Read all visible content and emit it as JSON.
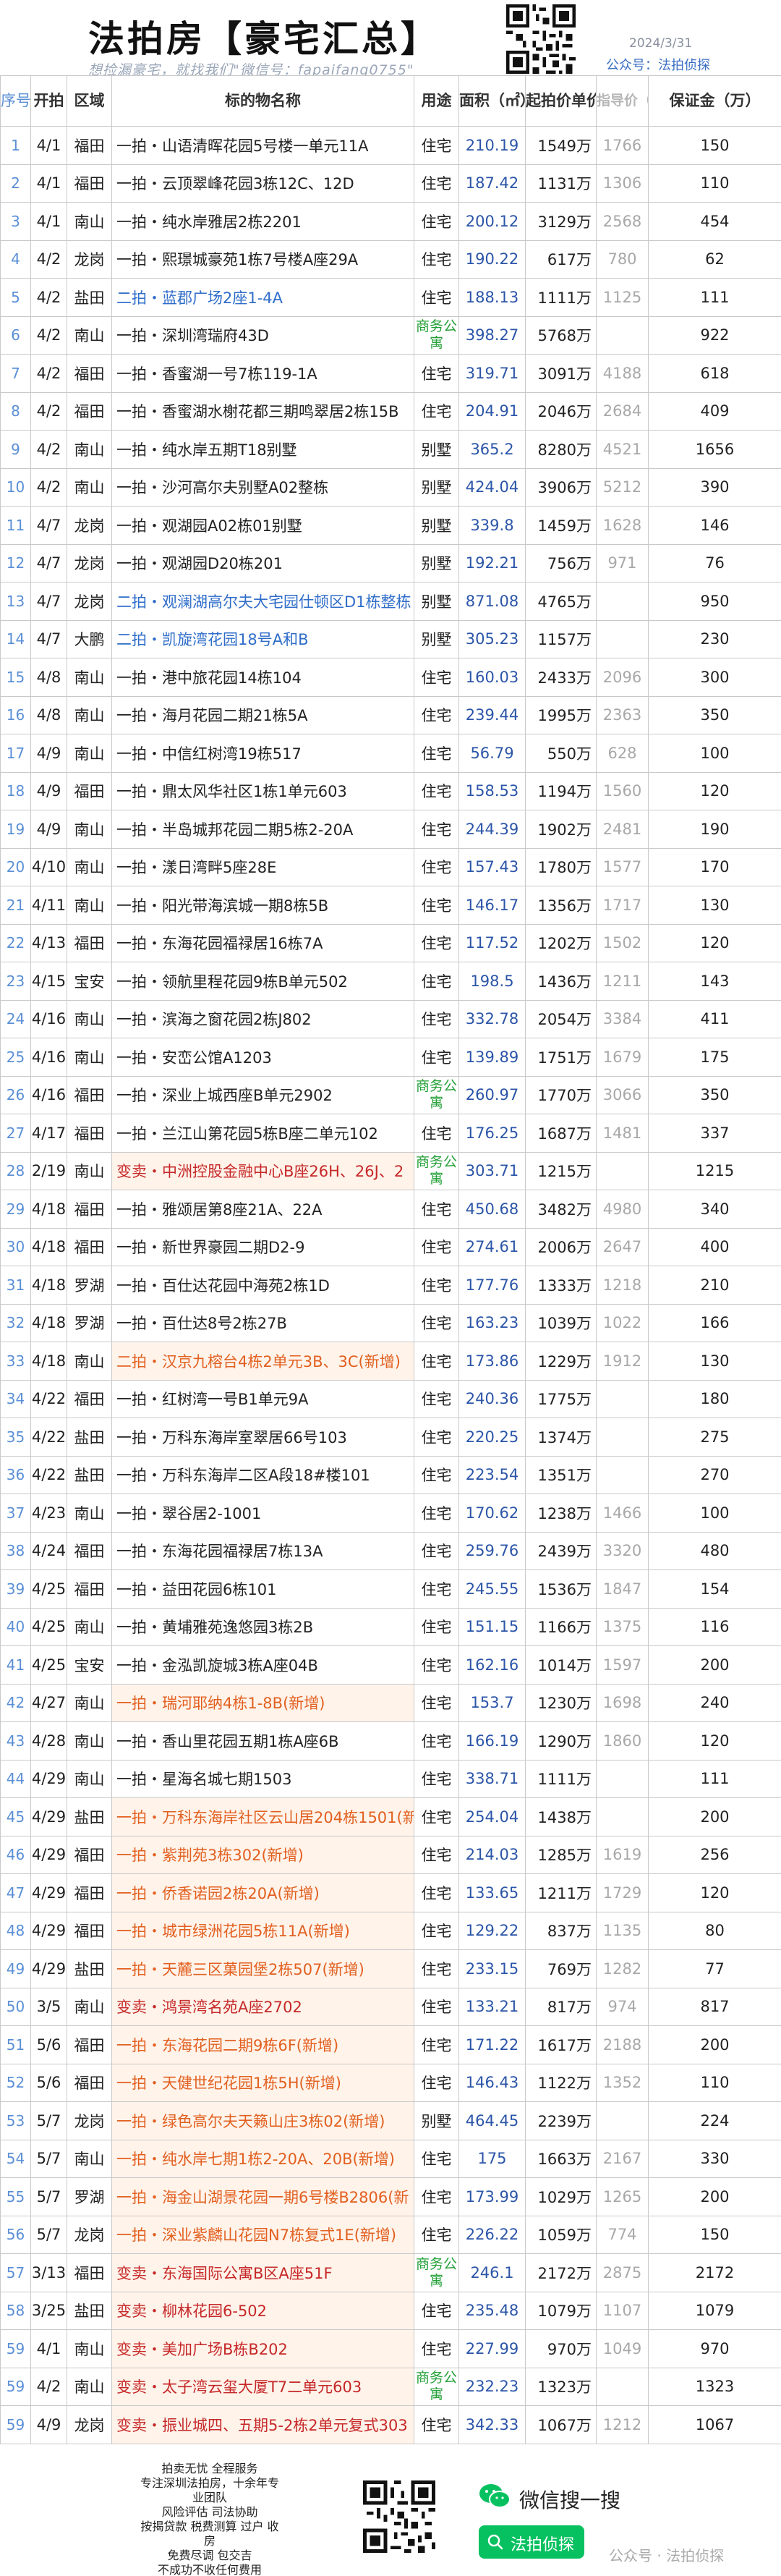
{
  "header": {
    "title": "法拍房【豪宅汇总】",
    "subtitle": "想捡漏豪宅，就找我们\"微信号：fapaifang0755\"",
    "date": "2024/3/31",
    "gzh": "公众号：法拍侦探"
  },
  "table": {
    "headers": {
      "idx": "序号",
      "date": "开拍",
      "district": "区域",
      "name": "标的物名称",
      "use": "用途",
      "area": "面积（㎡）",
      "price": "起拍价单价",
      "eval": "指导价（万）",
      "start": "起拍价（万）",
      "deposit": "保证金（万）"
    },
    "rows": [
      {
        "idx": "1",
        "date": "4/1",
        "district": "福田",
        "name": "一拍・山语清晖花园5号楼一单元11A",
        "use": "住宅",
        "area": "210.19",
        "price": "1549万",
        "eval": "1766",
        "deposit": "150",
        "style": ""
      },
      {
        "idx": "2",
        "date": "4/1",
        "district": "福田",
        "name": "一拍・云顶翠峰花园3栋12C、12D",
        "use": "住宅",
        "area": "187.42",
        "price": "1131万",
        "eval": "1306",
        "deposit": "110",
        "style": ""
      },
      {
        "idx": "3",
        "date": "4/1",
        "district": "南山",
        "name": "一拍・纯水岸雅居2栋2201",
        "use": "住宅",
        "area": "200.12",
        "price": "3129万",
        "eval": "2568",
        "deposit": "454",
        "style": ""
      },
      {
        "idx": "4",
        "date": "4/2",
        "district": "龙岗",
        "name": "一拍・熙璟城豪苑1栋7号楼A座29A",
        "use": "住宅",
        "area": "190.22",
        "price": "617万",
        "eval": "780",
        "deposit": "62",
        "style": ""
      },
      {
        "idx": "5",
        "date": "4/2",
        "district": "盐田",
        "name": "二拍・蓝郡广场2座1-4A",
        "use": "住宅",
        "area": "188.13",
        "price": "1111万",
        "eval": "1125",
        "deposit": "111",
        "style": "blue"
      },
      {
        "idx": "6",
        "date": "4/2",
        "district": "南山",
        "name": "一拍・深圳湾瑞府43D",
        "use": "商务公寓",
        "area": "398.27",
        "price": "5768万",
        "eval": "",
        "deposit": "922",
        "style": ""
      },
      {
        "idx": "7",
        "date": "4/2",
        "district": "福田",
        "name": "一拍・香蜜湖一号7栋119-1A",
        "use": "住宅",
        "area": "319.71",
        "price": "3091万",
        "eval": "4188",
        "deposit": "618",
        "style": ""
      },
      {
        "idx": "8",
        "date": "4/2",
        "district": "福田",
        "name": "一拍・香蜜湖水榭花都三期鸣翠居2栋15B",
        "use": "住宅",
        "area": "204.91",
        "price": "2046万",
        "eval": "2684",
        "deposit": "409",
        "style": ""
      },
      {
        "idx": "9",
        "date": "4/2",
        "district": "南山",
        "name": "一拍・纯水岸五期T18别墅",
        "use": "别墅",
        "area": "365.2",
        "price": "8280万",
        "eval": "4521",
        "deposit": "1656",
        "style": ""
      },
      {
        "idx": "10",
        "date": "4/2",
        "district": "南山",
        "name": "一拍・沙河高尔夫别墅A02整栋",
        "use": "别墅",
        "area": "424.04",
        "price": "3906万",
        "eval": "5212",
        "deposit": "390",
        "style": ""
      },
      {
        "idx": "11",
        "date": "4/7",
        "district": "龙岗",
        "name": "一拍・观湖园A02栋01别墅",
        "use": "别墅",
        "area": "339.8",
        "price": "1459万",
        "eval": "1628",
        "deposit": "146",
        "style": ""
      },
      {
        "idx": "12",
        "date": "4/7",
        "district": "龙岗",
        "name": "一拍・观湖园D20栋201",
        "use": "别墅",
        "area": "192.21",
        "price": "756万",
        "eval": "971",
        "deposit": "76",
        "style": ""
      },
      {
        "idx": "13",
        "date": "4/7",
        "district": "龙岗",
        "name": "二拍・观澜湖高尔夫大宅园仕顿区D1栋整栋",
        "use": "别墅",
        "area": "871.08",
        "price": "4765万",
        "eval": "",
        "deposit": "950",
        "style": "blue"
      },
      {
        "idx": "14",
        "date": "4/7",
        "district": "大鹏",
        "name": "二拍・凯旋湾花园18号A和B",
        "use": "别墅",
        "area": "305.23",
        "price": "1157万",
        "eval": "",
        "deposit": "230",
        "style": "blue"
      },
      {
        "idx": "15",
        "date": "4/8",
        "district": "南山",
        "name": "一拍・港中旅花园14栋104",
        "use": "住宅",
        "area": "160.03",
        "price": "2433万",
        "eval": "2096",
        "deposit": "300",
        "style": ""
      },
      {
        "idx": "16",
        "date": "4/8",
        "district": "南山",
        "name": "一拍・海月花园二期21栋5A",
        "use": "住宅",
        "area": "239.44",
        "price": "1995万",
        "eval": "2363",
        "deposit": "350",
        "style": ""
      },
      {
        "idx": "17",
        "date": "4/9",
        "district": "南山",
        "name": "一拍・中信红树湾19栋517",
        "use": "住宅",
        "area": "56.79",
        "price": "550万",
        "eval": "628",
        "deposit": "100",
        "style": ""
      },
      {
        "idx": "18",
        "date": "4/9",
        "district": "福田",
        "name": "一拍・鼎太风华社区1栋1单元603",
        "use": "住宅",
        "area": "158.53",
        "price": "1194万",
        "eval": "1560",
        "deposit": "120",
        "style": ""
      },
      {
        "idx": "19",
        "date": "4/9",
        "district": "南山",
        "name": "一拍・半岛城邦花园二期5栋2-20A",
        "use": "住宅",
        "area": "244.39",
        "price": "1902万",
        "eval": "2481",
        "deposit": "190",
        "style": ""
      },
      {
        "idx": "20",
        "date": "4/10",
        "district": "南山",
        "name": "一拍・漾日湾畔5座28E",
        "use": "住宅",
        "area": "157.43",
        "price": "1780万",
        "eval": "1577",
        "deposit": "170",
        "style": ""
      },
      {
        "idx": "21",
        "date": "4/11",
        "district": "南山",
        "name": "一拍・阳光带海滨城一期8栋5B",
        "use": "住宅",
        "area": "146.17",
        "price": "1356万",
        "eval": "1717",
        "deposit": "130",
        "style": ""
      },
      {
        "idx": "22",
        "date": "4/13",
        "district": "福田",
        "name": "一拍・东海花园福禄居16栋7A",
        "use": "住宅",
        "area": "117.52",
        "price": "1202万",
        "eval": "1502",
        "deposit": "120",
        "style": ""
      },
      {
        "idx": "23",
        "date": "4/15",
        "district": "宝安",
        "name": "一拍・领航里程花园9栋B单元502",
        "use": "住宅",
        "area": "198.5",
        "price": "1436万",
        "eval": "1211",
        "deposit": "143",
        "style": ""
      },
      {
        "idx": "24",
        "date": "4/16",
        "district": "南山",
        "name": "一拍・滨海之窗花园2栋J802",
        "use": "住宅",
        "area": "332.78",
        "price": "2054万",
        "eval": "3384",
        "deposit": "411",
        "style": ""
      },
      {
        "idx": "25",
        "date": "4/16",
        "district": "南山",
        "name": "一拍・安峦公馆A1203",
        "use": "住宅",
        "area": "139.89",
        "price": "1751万",
        "eval": "1679",
        "deposit": "175",
        "style": ""
      },
      {
        "idx": "26",
        "date": "4/16",
        "district": "福田",
        "name": "一拍・深业上城西座B单元2902",
        "use": "商务公寓",
        "area": "260.97",
        "price": "1770万",
        "eval": "3066",
        "deposit": "350",
        "style": ""
      },
      {
        "idx": "27",
        "date": "4/17",
        "district": "福田",
        "name": "一拍・兰江山第花园5栋B座二单元102",
        "use": "住宅",
        "area": "176.25",
        "price": "1687万",
        "eval": "1481",
        "deposit": "337",
        "style": ""
      },
      {
        "idx": "28",
        "date": "2/19",
        "district": "南山",
        "name": "变卖・中洲控股金融中心B座26H、26J、2",
        "use": "商务公寓",
        "area": "303.71",
        "price": "1215万",
        "eval": "",
        "deposit": "1215",
        "style": "red"
      },
      {
        "idx": "29",
        "date": "4/18",
        "district": "福田",
        "name": "一拍・雅颂居第8座21A、22A",
        "use": "住宅",
        "area": "450.68",
        "price": "3482万",
        "eval": "4980",
        "deposit": "340",
        "style": ""
      },
      {
        "idx": "30",
        "date": "4/18",
        "district": "福田",
        "name": "一拍・新世界豪园二期D2-9",
        "use": "住宅",
        "area": "274.61",
        "price": "2006万",
        "eval": "2647",
        "deposit": "400",
        "style": ""
      },
      {
        "idx": "31",
        "date": "4/18",
        "district": "罗湖",
        "name": "一拍・百仕达花园中海苑2栋1D",
        "use": "住宅",
        "area": "177.76",
        "price": "1333万",
        "eval": "1218",
        "deposit": "210",
        "style": ""
      },
      {
        "idx": "32",
        "date": "4/18",
        "district": "罗湖",
        "name": "一拍・百仕达8号2栋27B",
        "use": "住宅",
        "area": "163.23",
        "price": "1039万",
        "eval": "1022",
        "deposit": "166",
        "style": ""
      },
      {
        "idx": "33",
        "date": "4/18",
        "district": "南山",
        "name": "二拍・汉京九榕台4栋2单元3B、3C(新增)",
        "use": "住宅",
        "area": "173.86",
        "price": "1229万",
        "eval": "1912",
        "deposit": "130",
        "style": "orange"
      },
      {
        "idx": "34",
        "date": "4/22",
        "district": "福田",
        "name": "一拍・红树湾一号B1单元9A",
        "use": "住宅",
        "area": "240.36",
        "price": "1775万",
        "eval": "",
        "deposit": "180",
        "style": ""
      },
      {
        "idx": "35",
        "date": "4/22",
        "district": "盐田",
        "name": "一拍・万科东海岸室翠居66号103",
        "use": "住宅",
        "area": "220.25",
        "price": "1374万",
        "eval": "",
        "deposit": "275",
        "style": ""
      },
      {
        "idx": "36",
        "date": "4/22",
        "district": "盐田",
        "name": "一拍・万科东海岸二区A段18#楼101",
        "use": "住宅",
        "area": "223.54",
        "price": "1351万",
        "eval": "",
        "deposit": "270",
        "style": ""
      },
      {
        "idx": "37",
        "date": "4/23",
        "district": "南山",
        "name": "一拍・翠谷居2-1001",
        "use": "住宅",
        "area": "170.62",
        "price": "1238万",
        "eval": "1466",
        "deposit": "100",
        "style": ""
      },
      {
        "idx": "38",
        "date": "4/24",
        "district": "福田",
        "name": "一拍・东海花园福禄居7栋13A",
        "use": "住宅",
        "area": "259.76",
        "price": "2439万",
        "eval": "3320",
        "deposit": "480",
        "style": ""
      },
      {
        "idx": "39",
        "date": "4/25",
        "district": "福田",
        "name": "一拍・益田花园6栋101",
        "use": "住宅",
        "area": "245.55",
        "price": "1536万",
        "eval": "1847",
        "deposit": "154",
        "style": ""
      },
      {
        "idx": "40",
        "date": "4/25",
        "district": "南山",
        "name": "一拍・黄埔雅苑逸悠园3栋2B",
        "use": "住宅",
        "area": "151.15",
        "price": "1166万",
        "eval": "1375",
        "deposit": "116",
        "style": ""
      },
      {
        "idx": "41",
        "date": "4/25",
        "district": "宝安",
        "name": "一拍・金泓凯旋城3栋A座04B",
        "use": "住宅",
        "area": "162.16",
        "price": "1014万",
        "eval": "1597",
        "deposit": "200",
        "style": ""
      },
      {
        "idx": "42",
        "date": "4/27",
        "district": "南山",
        "name": "一拍・瑞河耶纳4栋1-8B(新增)",
        "use": "住宅",
        "area": "153.7",
        "price": "1230万",
        "eval": "1698",
        "deposit": "240",
        "style": "orange"
      },
      {
        "idx": "43",
        "date": "4/28",
        "district": "南山",
        "name": "一拍・香山里花园五期1栋A座6B",
        "use": "住宅",
        "area": "166.19",
        "price": "1290万",
        "eval": "1860",
        "deposit": "120",
        "style": ""
      },
      {
        "idx": "44",
        "date": "4/29",
        "district": "南山",
        "name": "一拍・星海名城七期1503",
        "use": "住宅",
        "area": "338.71",
        "price": "1111万",
        "eval": "",
        "deposit": "111",
        "style": ""
      },
      {
        "idx": "45",
        "date": "4/29",
        "district": "盐田",
        "name": "一拍・万科东海岸社区云山居204栋1501(新",
        "use": "住宅",
        "area": "254.04",
        "price": "1438万",
        "eval": "",
        "deposit": "200",
        "style": "orange"
      },
      {
        "idx": "46",
        "date": "4/29",
        "district": "福田",
        "name": "一拍・紫荆苑3栋302(新增)",
        "use": "住宅",
        "area": "214.03",
        "price": "1285万",
        "eval": "1619",
        "deposit": "256",
        "style": "orange"
      },
      {
        "idx": "47",
        "date": "4/29",
        "district": "福田",
        "name": "一拍・侨香诺园2栋20A(新增)",
        "use": "住宅",
        "area": "133.65",
        "price": "1211万",
        "eval": "1729",
        "deposit": "120",
        "style": "orange"
      },
      {
        "idx": "48",
        "date": "4/29",
        "district": "福田",
        "name": "一拍・城市绿洲花园5栋11A(新增)",
        "use": "住宅",
        "area": "129.22",
        "price": "837万",
        "eval": "1135",
        "deposit": "80",
        "style": "orange"
      },
      {
        "idx": "49",
        "date": "4/29",
        "district": "盐田",
        "name": "一拍・天麓三区菓园堡2栋507(新增)",
        "use": "住宅",
        "area": "233.15",
        "price": "769万",
        "eval": "1282",
        "deposit": "77",
        "style": "orange"
      },
      {
        "idx": "50",
        "date": "3/5",
        "district": "南山",
        "name": "变卖・鸿景湾名苑A座2702",
        "use": "住宅",
        "area": "133.21",
        "price": "817万",
        "eval": "974",
        "deposit": "817",
        "style": "red"
      },
      {
        "idx": "51",
        "date": "5/6",
        "district": "福田",
        "name": "一拍・东海花园二期9栋6F(新增)",
        "use": "住宅",
        "area": "171.22",
        "price": "1617万",
        "eval": "2188",
        "deposit": "200",
        "style": "orange"
      },
      {
        "idx": "52",
        "date": "5/6",
        "district": "福田",
        "name": "一拍・天健世纪花园1栋5H(新增)",
        "use": "住宅",
        "area": "146.43",
        "price": "1122万",
        "eval": "1352",
        "deposit": "110",
        "style": "orange"
      },
      {
        "idx": "53",
        "date": "5/7",
        "district": "龙岗",
        "name": "一拍・绿色高尔夫天籁山庄3栋02(新增)",
        "use": "别墅",
        "area": "464.45",
        "price": "2239万",
        "eval": "",
        "deposit": "224",
        "style": "orange"
      },
      {
        "idx": "54",
        "date": "5/7",
        "district": "南山",
        "name": "一拍・纯水岸七期1栋2-20A、20B(新增)",
        "use": "住宅",
        "area": "175",
        "price": "1663万",
        "eval": "2167",
        "deposit": "330",
        "style": "orange"
      },
      {
        "idx": "55",
        "date": "5/7",
        "district": "罗湖",
        "name": "一拍・海金山湖景花园一期6号楼B2806(新",
        "use": "住宅",
        "area": "173.99",
        "price": "1029万",
        "eval": "1265",
        "deposit": "200",
        "style": "orange"
      },
      {
        "idx": "56",
        "date": "5/7",
        "district": "龙岗",
        "name": "一拍・深业紫麟山花园N7栋复式1E(新增)",
        "use": "住宅",
        "area": "226.22",
        "price": "1059万",
        "eval": "774",
        "deposit": "150",
        "style": "orange"
      },
      {
        "idx": "57",
        "date": "3/13",
        "district": "福田",
        "name": "变卖・东海国际公寓B区A座51F",
        "use": "商务公寓",
        "area": "246.1",
        "price": "2172万",
        "eval": "2875",
        "deposit": "2172",
        "style": "red"
      },
      {
        "idx": "58",
        "date": "3/25",
        "district": "盐田",
        "name": "变卖・柳林花园6-502",
        "use": "住宅",
        "area": "235.48",
        "price": "1079万",
        "eval": "1107",
        "deposit": "1079",
        "style": "red"
      },
      {
        "idx": "59",
        "date": "4/1",
        "district": "南山",
        "name": "变卖・美加广场B栋B202",
        "use": "住宅",
        "area": "227.99",
        "price": "970万",
        "eval": "1049",
        "deposit": "970",
        "style": "red"
      },
      {
        "idx": "59",
        "date": "4/2",
        "district": "南山",
        "name": "变卖・太子湾云玺大厦T7二单元603",
        "use": "商务公寓",
        "area": "232.23",
        "price": "1323万",
        "eval": "",
        "deposit": "1323",
        "style": "red"
      },
      {
        "idx": "59",
        "date": "4/9",
        "district": "龙岗",
        "name": "变卖・振业城四、五期5-2栋2单元复式303",
        "use": "住宅",
        "area": "342.33",
        "price": "1067万",
        "eval": "1212",
        "deposit": "1067",
        "style": "red"
      }
    ]
  },
  "footer": {
    "lines": [
      "拍卖无忧 全程服务",
      "专注深圳法拍房，十余年专业团队",
      "风险评估 司法协助",
      "按揭贷款 税费测算 过户 收房",
      "免费尽调 包交吉",
      "不成功不收任何费用"
    ],
    "wx_label": "微信搜一搜",
    "wx_search": "法拍侦探",
    "gzh": "公众号 · 法拍侦探"
  }
}
